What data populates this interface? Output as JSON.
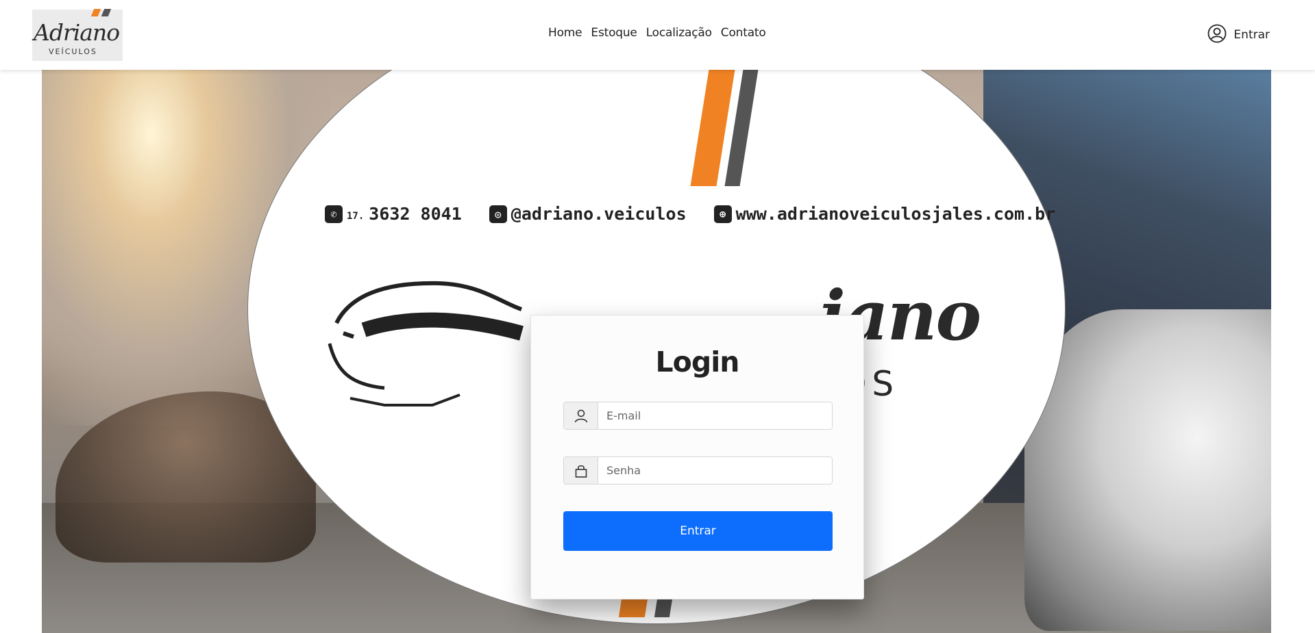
{
  "brand": {
    "name": "Adriano",
    "sub": "VEÍCULOS"
  },
  "nav": {
    "items": [
      "Home",
      "Estoque",
      "Localização",
      "Contato"
    ]
  },
  "user": {
    "label": "Entrar"
  },
  "banner": {
    "phone_prefix": "17.",
    "phone": "3632 8041",
    "instagram": "@adriano.veiculos",
    "website": "www.adrianoveiculosjales.com.br",
    "wordmark": "iano",
    "wordsub": "LOS"
  },
  "login": {
    "title": "Login",
    "email_placeholder": "E-mail",
    "password_placeholder": "Senha",
    "submit_label": "Entrar"
  },
  "colors": {
    "accent": "#0d6efd",
    "orange": "#f08223",
    "dark": "#555555"
  }
}
